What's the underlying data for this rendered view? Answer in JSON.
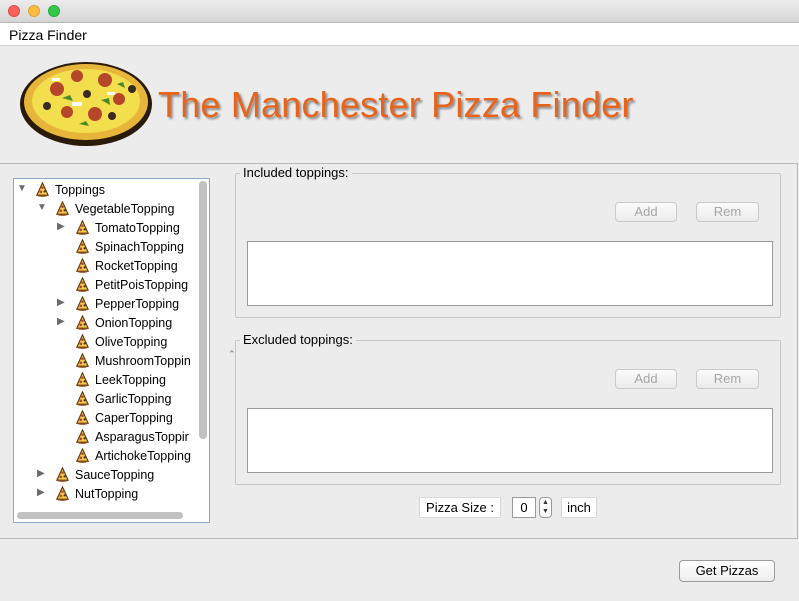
{
  "window": {
    "controls": [
      "close",
      "minimize",
      "zoom"
    ]
  },
  "menu": {
    "app_label": "Pizza Finder"
  },
  "banner": {
    "title": "The Manchester Pizza Finder",
    "title_color": "#e8641c",
    "logo_icon": "pizza-logo-icon"
  },
  "tree": {
    "item_icon": "pizza-slice-icon",
    "items": [
      {
        "label": "Toppings",
        "level": 0,
        "state": "expanded"
      },
      {
        "label": "VegetableTopping",
        "level": 1,
        "state": "expanded"
      },
      {
        "label": "TomatoTopping",
        "level": 2,
        "state": "collapsed"
      },
      {
        "label": "SpinachTopping",
        "level": 2,
        "state": "leaf"
      },
      {
        "label": "RocketTopping",
        "level": 2,
        "state": "leaf"
      },
      {
        "label": "PetitPoisTopping",
        "level": 2,
        "state": "leaf"
      },
      {
        "label": "PepperTopping",
        "level": 2,
        "state": "collapsed"
      },
      {
        "label": "OnionTopping",
        "level": 2,
        "state": "collapsed"
      },
      {
        "label": "OliveTopping",
        "level": 2,
        "state": "leaf"
      },
      {
        "label": "MushroomToppin",
        "level": 2,
        "state": "leaf"
      },
      {
        "label": "LeekTopping",
        "level": 2,
        "state": "leaf"
      },
      {
        "label": "GarlicTopping",
        "level": 2,
        "state": "leaf"
      },
      {
        "label": "CaperTopping",
        "level": 2,
        "state": "leaf"
      },
      {
        "label": "AsparagusToppir",
        "level": 2,
        "state": "leaf"
      },
      {
        "label": "ArtichokeTopping",
        "level": 2,
        "state": "leaf"
      },
      {
        "label": "SauceTopping",
        "level": 1,
        "state": "collapsed"
      },
      {
        "label": "NutTopping",
        "level": 1,
        "state": "collapsed"
      }
    ]
  },
  "included": {
    "title": "Included toppings:",
    "add_label": "Add",
    "rem_label": "Rem"
  },
  "excluded": {
    "title": "Excluded toppings:",
    "add_label": "Add",
    "rem_label": "Rem"
  },
  "size": {
    "label": "Pizza Size :",
    "value": "0",
    "unit": "inch"
  },
  "actions": {
    "get_pizzas_label": "Get Pizzas"
  }
}
